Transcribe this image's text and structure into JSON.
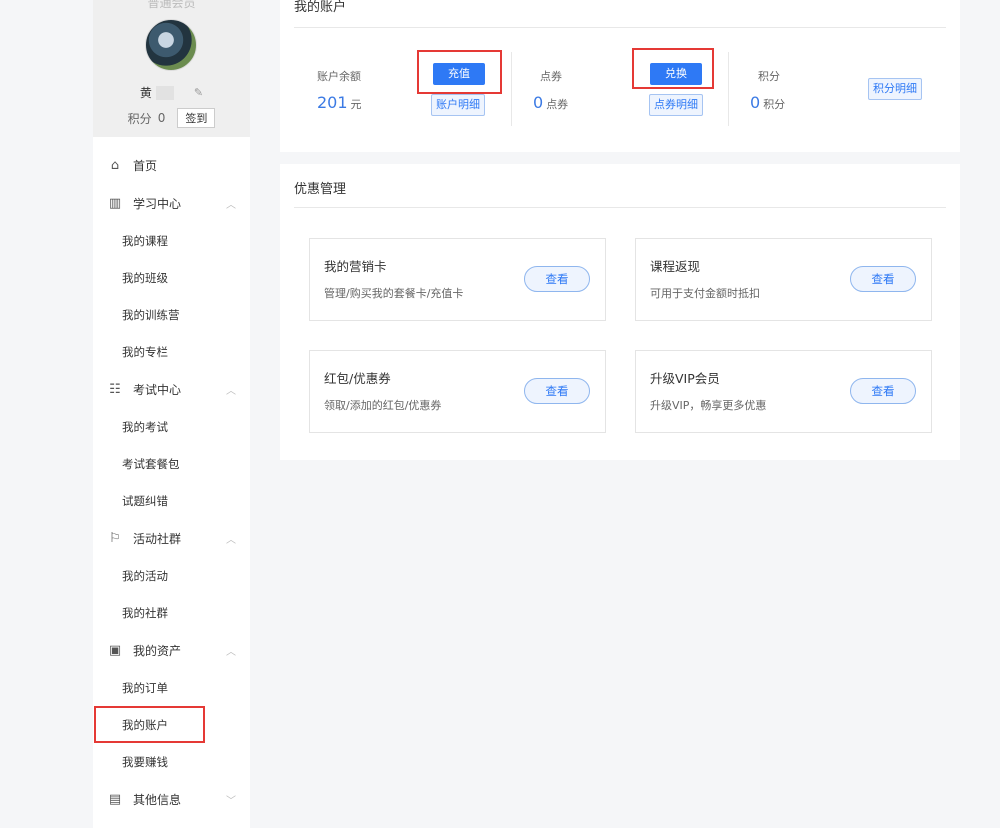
{
  "profile": {
    "top_label": "普通会员",
    "name": "黄",
    "points_label": "积分",
    "points_value": "0",
    "signin_label": "签到"
  },
  "menu": {
    "home": "首页",
    "study": "学习中心",
    "my_courses": "我的课程",
    "my_classes": "我的班级",
    "my_camps": "我的训练营",
    "my_columns": "我的专栏",
    "exam": "考试中心",
    "my_exams": "我的考试",
    "exam_packages": "考试套餐包",
    "question_errors": "试题纠错",
    "activity": "活动社群",
    "my_activities": "我的活动",
    "my_communities": "我的社群",
    "assets": "我的资产",
    "my_orders": "我的订单",
    "my_account": "我的账户",
    "earn_money": "我要赚钱",
    "other": "其他信息"
  },
  "account": {
    "title": "我的账户",
    "balance_label": "账户余额",
    "balance_value": "201",
    "balance_unit": "元",
    "recharge_btn": "充值",
    "balance_detail_btn": "账户明细",
    "voucher_label": "点券",
    "voucher_value": "0",
    "voucher_unit": "点券",
    "exchange_btn": "兑换",
    "voucher_detail_btn": "点券明细",
    "points_label": "积分",
    "points_value": "0",
    "points_unit": "积分",
    "points_detail_btn": "积分明细"
  },
  "promo": {
    "title": "优惠管理",
    "items": [
      {
        "title": "我的营销卡",
        "desc": "管理/购买我的套餐卡/充值卡",
        "button": "查看"
      },
      {
        "title": "课程返现",
        "desc": "可用于支付金额时抵扣",
        "button": "查看"
      },
      {
        "title": "红包/优惠券",
        "desc": "领取/添加的红包/优惠券",
        "button": "查看"
      },
      {
        "title": "升级VIP会员",
        "desc": "升级VIP，畅享更多优惠",
        "button": "查看"
      }
    ]
  },
  "colors": {
    "primary": "#2e79f5",
    "highlight_box": "#e53935",
    "value_blue": "#3b7ae4"
  },
  "icons": [
    "home-icon",
    "book-icon",
    "exam-icon",
    "flag-icon",
    "wallet-icon",
    "note-icon",
    "chevron-up-icon",
    "chevron-down-icon",
    "edit-icon"
  ]
}
